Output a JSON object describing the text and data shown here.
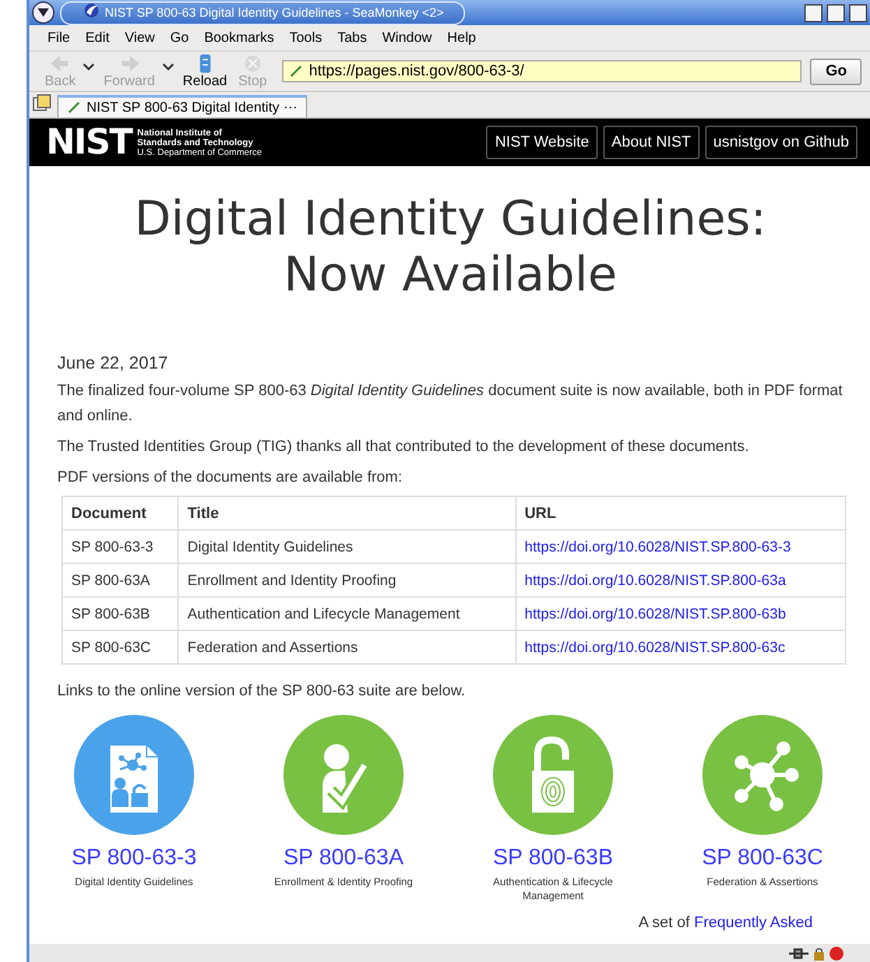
{
  "window": {
    "title": "NIST SP 800-63 Digital Identity Guidelines - SeaMonkey <2>"
  },
  "menu": [
    "File",
    "Edit",
    "View",
    "Go",
    "Bookmarks",
    "Tools",
    "Tabs",
    "Window",
    "Help"
  ],
  "toolbar": {
    "buttons": [
      {
        "label": "Back",
        "kind": "back",
        "disabled": true
      },
      {
        "label": "Forward",
        "kind": "forward",
        "disabled": true
      },
      {
        "label": "Reload",
        "kind": "reload",
        "disabled": false
      },
      {
        "label": "Stop",
        "kind": "stop",
        "disabled": true
      }
    ],
    "address": "https://pages.nist.gov/800-63-3/",
    "go": "Go"
  },
  "tabs": [
    {
      "label": "NIST SP 800-63 Digital Identity ⋯",
      "selected": true
    }
  ],
  "site_header": {
    "logo": "NIST",
    "logo_lines": [
      "National Institute of",
      "Standards and Technology",
      "U.S. Department of Commerce"
    ],
    "nav": [
      "NIST Website",
      "About NIST",
      "usnistgov on Github"
    ]
  },
  "page": {
    "heading": "Digital Identity Guidelines: Now Available",
    "date": "June 22, 2017",
    "paragraphs": [
      "The finalized four-volume SP 800-63 *Digital Identity Guidelines* document suite is now available, both in PDF format and online.",
      "The Trusted Identities Group (TIG) thanks all that contributed to the development of these documents.",
      "PDF versions of the documents are available from:"
    ],
    "table": {
      "columns": [
        "Document",
        "Title",
        "URL"
      ],
      "rows": [
        [
          "SP 800-63-3",
          "Digital Identity Guidelines",
          "https://doi.org/10.6028/NIST.SP.800-63-3"
        ],
        [
          "SP 800-63A",
          "Enrollment and Identity Proofing",
          "https://doi.org/10.6028/NIST.SP.800-63a"
        ],
        [
          "SP 800-63B",
          "Authentication and Lifecycle Management",
          "https://doi.org/10.6028/NIST.SP.800-63b"
        ],
        [
          "SP 800-63C",
          "Federation and Assertions",
          "https://doi.org/10.6028/NIST.SP.800-63c"
        ]
      ]
    },
    "links_intro": "Links to the online version of the SP 800-63 suite are below.",
    "cards": [
      {
        "title": "SP 800-63-3",
        "subtitle": "Digital Identity Guidelines",
        "kind": "document",
        "color": "#4aa3ea"
      },
      {
        "title": "SP 800-63A",
        "subtitle": "Enrollment & Identity Proofing",
        "kind": "person-check",
        "color": "#79c143"
      },
      {
        "title": "SP 800-63B",
        "subtitle": "Authentication & Lifecycle Management",
        "kind": "padlock",
        "color": "#79c143"
      },
      {
        "title": "SP 800-63C",
        "subtitle": "Federation & Assertions",
        "kind": "network",
        "color": "#79c143"
      }
    ],
    "faq": {
      "text": "A set of",
      "link": "Frequently Asked"
    }
  }
}
